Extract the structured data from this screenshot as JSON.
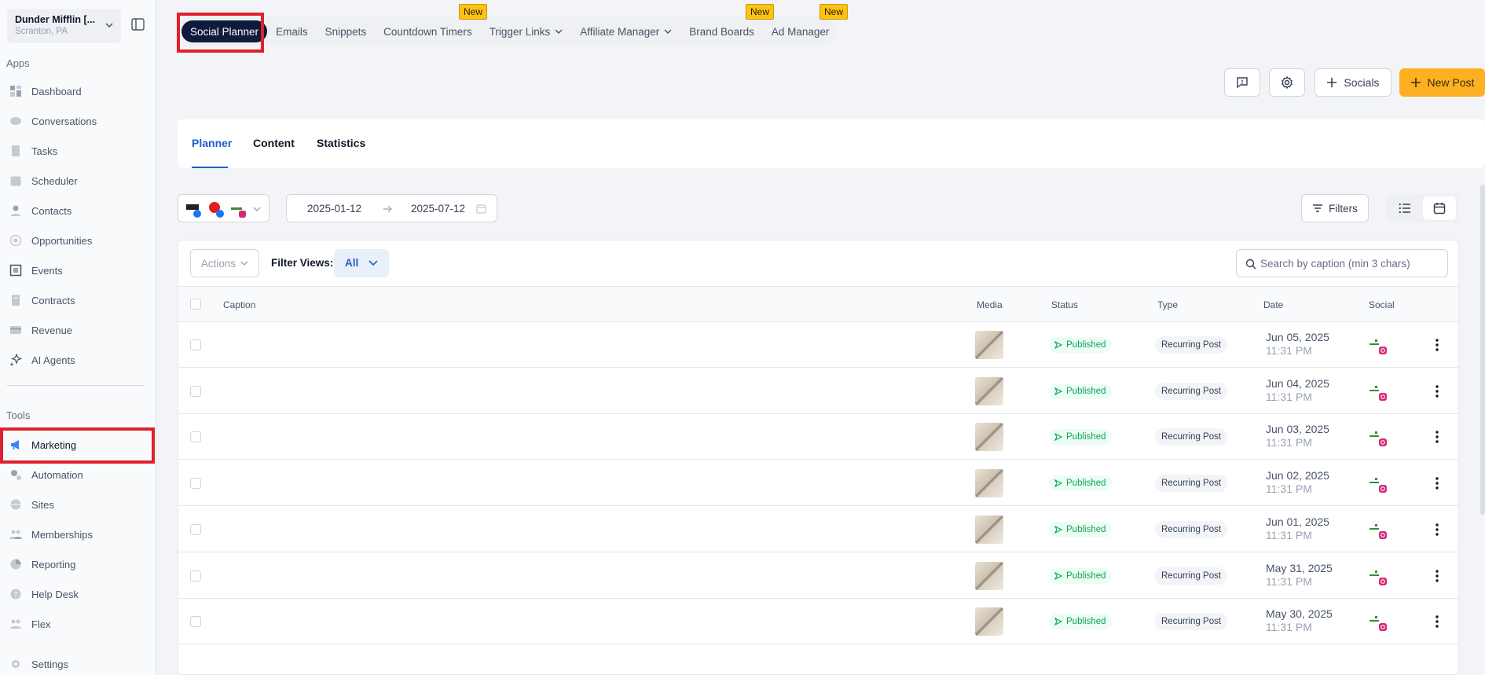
{
  "sidebar": {
    "account_name": "Dunder Mifflin [...",
    "account_location": "Scranton, PA",
    "apps_label": "Apps",
    "tools_label": "Tools",
    "apps": [
      {
        "label": "Dashboard",
        "icon": "dashboard-icon"
      },
      {
        "label": "Conversations",
        "icon": "chat-icon"
      },
      {
        "label": "Tasks",
        "icon": "tasks-icon"
      },
      {
        "label": "Scheduler",
        "icon": "calendar-icon"
      },
      {
        "label": "Contacts",
        "icon": "user-icon"
      },
      {
        "label": "Opportunities",
        "icon": "target-icon"
      },
      {
        "label": "Events",
        "icon": "events-icon"
      },
      {
        "label": "Contracts",
        "icon": "document-icon"
      },
      {
        "label": "Revenue",
        "icon": "card-icon"
      },
      {
        "label": "AI Agents",
        "icon": "sparkle-icon"
      }
    ],
    "tools": [
      {
        "label": "Marketing",
        "icon": "megaphone-icon",
        "active": true
      },
      {
        "label": "Automation",
        "icon": "gears-icon"
      },
      {
        "label": "Sites",
        "icon": "globe-icon"
      },
      {
        "label": "Memberships",
        "icon": "group-icon"
      },
      {
        "label": "Reporting",
        "icon": "pie-icon"
      },
      {
        "label": "Help Desk",
        "icon": "help-icon"
      },
      {
        "label": "Flex",
        "icon": "flex-icon"
      }
    ],
    "settings_label": "Settings"
  },
  "topnav": {
    "tabs": [
      {
        "label": "Social Planner",
        "active": true
      },
      {
        "label": "Emails"
      },
      {
        "label": "Snippets"
      },
      {
        "label": "Countdown Timers",
        "badge": "New"
      },
      {
        "label": "Trigger Links",
        "dropdown": true
      },
      {
        "label": "Affiliate Manager",
        "dropdown": true
      },
      {
        "label": "Brand Boards",
        "badge": "New"
      },
      {
        "label": "Ad Manager",
        "badge": "New"
      }
    ]
  },
  "toolbar": {
    "socials_label": "Socials",
    "new_post_label": "New Post"
  },
  "subtabs": [
    "Planner",
    "Content",
    "Statistics"
  ],
  "filters": {
    "date_start": "2025-01-12",
    "date_end": "2025-07-12",
    "filters_label": "Filters"
  },
  "table": {
    "actions_label": "Actions",
    "filter_views_label": "Filter Views:",
    "filter_views_value": "All",
    "search_placeholder": "Search by caption (min 3 chars)",
    "columns": [
      "Caption",
      "Media",
      "Status",
      "Type",
      "Date",
      "Social"
    ],
    "rows": [
      {
        "status": "Published",
        "type": "Recurring Post",
        "date": "Jun 05, 2025",
        "time": "11:31 PM"
      },
      {
        "status": "Published",
        "type": "Recurring Post",
        "date": "Jun 04, 2025",
        "time": "11:31 PM"
      },
      {
        "status": "Published",
        "type": "Recurring Post",
        "date": "Jun 03, 2025",
        "time": "11:31 PM"
      },
      {
        "status": "Published",
        "type": "Recurring Post",
        "date": "Jun 02, 2025",
        "time": "11:31 PM"
      },
      {
        "status": "Published",
        "type": "Recurring Post",
        "date": "Jun 01, 2025",
        "time": "11:31 PM"
      },
      {
        "status": "Published",
        "type": "Recurring Post",
        "date": "May 31, 2025",
        "time": "11:31 PM"
      },
      {
        "status": "Published",
        "type": "Recurring Post",
        "date": "May 30, 2025",
        "time": "11:31 PM"
      }
    ]
  },
  "colors": {
    "accent": "#fdb022",
    "active_tab": "#101a3b",
    "link_blue": "#1d5fc4",
    "published_green": "#12a15b",
    "highlight_red": "#e0202f"
  }
}
